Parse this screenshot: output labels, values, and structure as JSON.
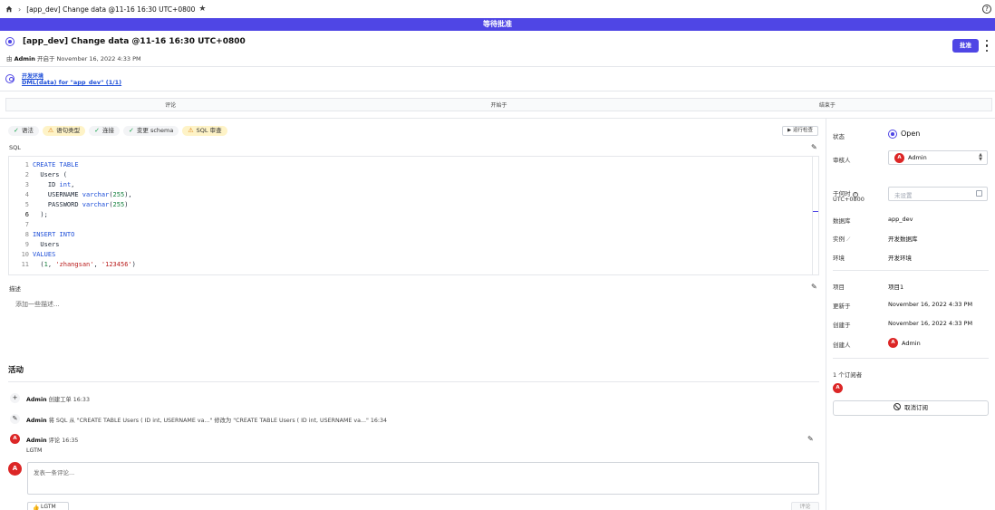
{
  "topbar": {
    "title": "[app_dev] Change data @11-16 16:30 UTC+0800"
  },
  "banner": {
    "text": "等待批准"
  },
  "issue": {
    "title": "[app_dev] Change data @11-16 16:30 UTC+0800",
    "creator": "Admin",
    "opened_text": "开启于 November 16, 2022 4:33 PM",
    "by_prefix": "由",
    "approve_label": "批准"
  },
  "pipeline": {
    "env_label": "开发环境",
    "task_label": "DML(data) for \"app_dev\" (1/1)"
  },
  "stage_columns": [
    "评论",
    "开始于",
    "结束于"
  ],
  "checks": [
    {
      "label": "语法",
      "status": "ok"
    },
    {
      "label": "语句类型",
      "status": "warn"
    },
    {
      "label": "连接",
      "status": "ok"
    },
    {
      "label": "变更 schema",
      "status": "ok"
    },
    {
      "label": "SQL 审查",
      "status": "warn"
    }
  ],
  "run_check_label": "运行检查",
  "sql": {
    "label": "SQL",
    "lines": [
      "1",
      "2",
      "3",
      "4",
      "5",
      "6",
      "7",
      "8",
      "9",
      "10",
      "11"
    ]
  },
  "description": {
    "label": "描述",
    "placeholder": "添加一些描述..."
  },
  "activity": {
    "title": "活动",
    "items": [
      {
        "user": "Admin",
        "text": "创建工单 16:33"
      },
      {
        "user": "Admin",
        "text": "将 SQL 从 \"CREATE TABLE Users ( ID int, USERNAME va...\" 修改为 \"CREATE TABLE Users ( ID int, USERNAME va...\" 16:34"
      },
      {
        "user": "Admin",
        "text": "评论 16:35",
        "body": "LGTM"
      }
    ],
    "comment_placeholder": "发表一条评论...",
    "lgtm_label": "LGTM",
    "comment_button": "评论"
  },
  "sidebar": {
    "status_label": "状态",
    "status_value": "Open",
    "assignee_label": "审核人",
    "assignee_value": "Admin",
    "assignee_initial": "A",
    "when_label": "于何时",
    "when_tz": "UTC+0800",
    "when_placeholder": "未设置",
    "database_label": "数据库",
    "database_value": "app_dev",
    "instance_label": "实例",
    "instance_value": "开发数据库",
    "env_label": "环境",
    "env_value": "开发环境",
    "project_label": "项目",
    "project_value": "项目1",
    "updated_label": "更新于",
    "updated_value": "November 16, 2022 4:33 PM",
    "created_label": "创建于",
    "created_value": "November 16, 2022 4:33 PM",
    "creator_label": "创建人",
    "creator_value": "Admin",
    "subscribers_label": "1 个订阅者",
    "unsubscribe_label": "取消订阅"
  },
  "colors": {
    "accent": "#4f46e5",
    "avatar": "#dc2626"
  }
}
